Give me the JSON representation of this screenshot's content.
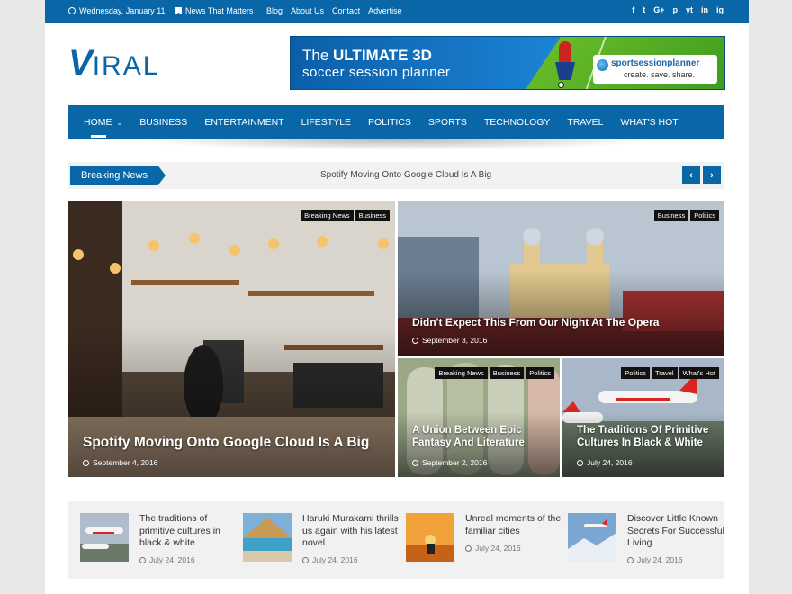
{
  "topbar": {
    "date": "Wednesday, January 11",
    "tagline": "News That Matters",
    "menu": [
      "Blog",
      "About Us",
      "Contact",
      "Advertise"
    ],
    "social": [
      "f",
      "t",
      "G+",
      "p",
      "yt",
      "in",
      "ig"
    ]
  },
  "logo": {
    "first": "V",
    "rest": "IRAL"
  },
  "banner": {
    "line1_pre": "The ",
    "line1_bold": "ULTIMATE 3D",
    "line2": "soccer session planner",
    "brand": "sportsessionplanner",
    "slogan": "create. save. share."
  },
  "nav": {
    "items": [
      "HOME",
      "BUSINESS",
      "ENTERTAINMENT",
      "LIFESTYLE",
      "POLITICS",
      "SPORTS",
      "TECHNOLOGY",
      "TRAVEL",
      "WHAT'S HOT"
    ],
    "active": "HOME",
    "caret": "⌄"
  },
  "breaking": {
    "label": "Breaking News",
    "headline": "Spotify Moving Onto Google Cloud Is A Big",
    "prev": "‹",
    "next": "›"
  },
  "featured": {
    "main": {
      "tags": [
        "Breaking News",
        "Business"
      ],
      "title": "Spotify Moving Onto Google Cloud Is A Big",
      "date": "September 4, 2016"
    },
    "top_right": {
      "tags": [
        "Business",
        "Politics"
      ],
      "title": "Didn't Expect This From Our Night At The Opera",
      "date": "September 3, 2016"
    },
    "bottom_left": {
      "tags": [
        "Breaking News",
        "Business",
        "Politics"
      ],
      "title": "A Union Between Epic Fantasy And Literature",
      "date": "September 2, 2016"
    },
    "bottom_right": {
      "tags": [
        "Politics",
        "Travel",
        "What's Hot"
      ],
      "title": "The Traditions Of Primitive Cultures In Black & White",
      "date": "July 24, 2016"
    }
  },
  "strip": [
    {
      "title": "The traditions of primitive cultures in black & white",
      "date": "July 24, 2016"
    },
    {
      "title": "Haruki Murakami thrills us again with his latest novel",
      "date": "July 24, 2016"
    },
    {
      "title": "Unreal moments of the familiar cities",
      "date": "July 24, 2016"
    },
    {
      "title": "Discover Little Known Secrets For Successful Living",
      "date": "July 24, 2016"
    }
  ],
  "colors": {
    "brand": "#0a67a7",
    "tag_bg": "#111111"
  }
}
